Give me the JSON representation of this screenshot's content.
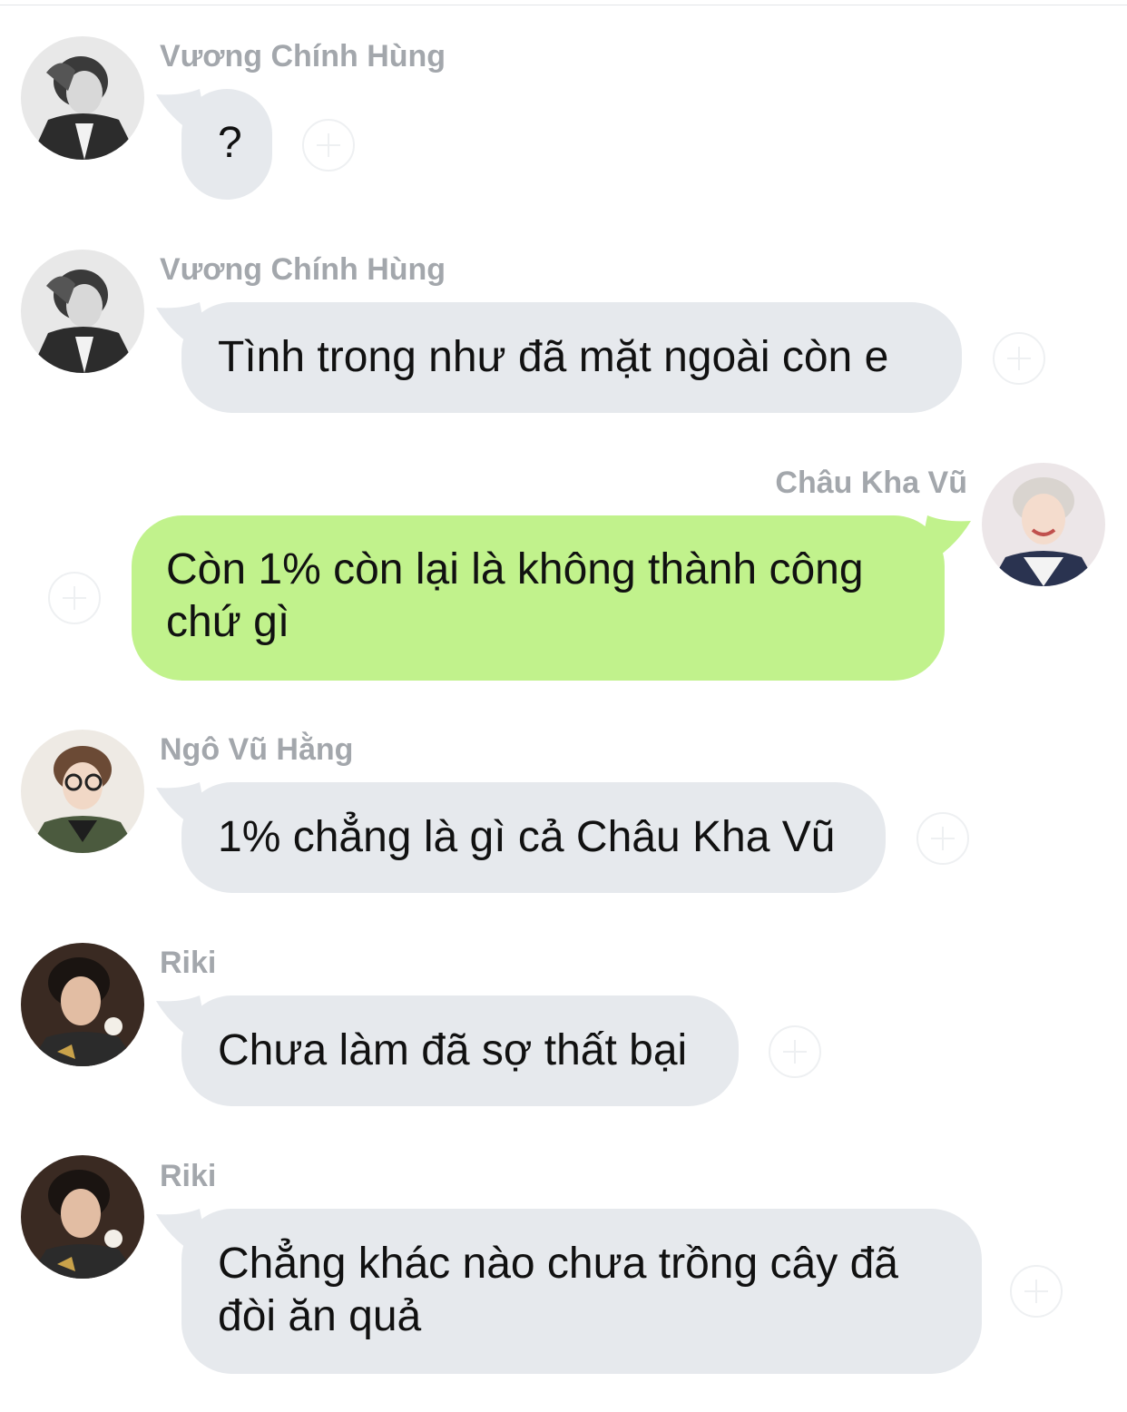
{
  "chat": {
    "messages": [
      {
        "sender": "Vương Chính Hùng",
        "text": "?",
        "direction": "in"
      },
      {
        "sender": "Vương Chính Hùng",
        "text": "Tình trong như đã mặt ngoài còn e",
        "direction": "in"
      },
      {
        "sender": "Châu Kha Vũ",
        "text": "Còn 1% còn lại là không thành công chứ gì",
        "direction": "out"
      },
      {
        "sender": "Ngô Vũ Hằng",
        "text": "1% chẳng là gì cả Châu Kha Vũ",
        "direction": "in"
      },
      {
        "sender": "Riki",
        "text": "Chưa làm đã sợ thất bại",
        "direction": "in"
      },
      {
        "sender": "Riki",
        "text": "Chẳng khác nào chưa trồng cây đã đòi ăn quả",
        "direction": "in"
      }
    ]
  },
  "colors": {
    "incoming_bubble": "#e6e9ed",
    "outgoing_bubble": "#c1f28c",
    "sender_name": "#a3a7ac",
    "message_text": "#111111"
  },
  "icons": [
    "avatar-photo",
    "add-reaction-icon"
  ]
}
